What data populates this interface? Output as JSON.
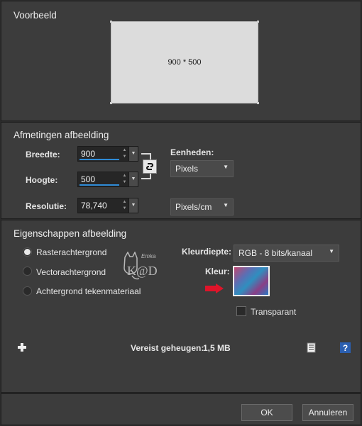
{
  "preview": {
    "title": "Voorbeeld",
    "size_label": "900 * 500"
  },
  "dimensions": {
    "title": "Afmetingen afbeelding",
    "width_label": "Breedte:",
    "width_value": "900",
    "height_label": "Hoogte:",
    "height_value": "500",
    "resolution_label": "Resolutie:",
    "resolution_value": "78,740",
    "units_label": "Eenheden:",
    "units_value": "Pixels",
    "resolution_units_value": "Pixels/cm"
  },
  "properties": {
    "title": "Eigenschappen afbeelding",
    "options": [
      "Rasterachtergrond",
      "Vectorachtergrond",
      "Achtergrond tekenmateriaal"
    ],
    "selected_option": "Rasterachtergrond",
    "color_depth_label": "Kleurdiepte:",
    "color_depth_value": "RGB - 8 bits/kanaal",
    "color_label": "Kleur:",
    "transparent_label": "Transparant",
    "transparent_checked": false,
    "memory_label": "Vereist geheugen:",
    "memory_value": "1,5 MB",
    "watermark_top": "Emka",
    "watermark_text": "K@D"
  },
  "footer": {
    "ok_label": "OK",
    "cancel_label": "Annuleren"
  },
  "colors": {
    "accent": "#2f8bd6",
    "arrow": "#e0142a"
  },
  "icons": [
    "plus-icon",
    "link-icon",
    "presets-icon",
    "help-icon",
    "arrow-right-icon"
  ]
}
